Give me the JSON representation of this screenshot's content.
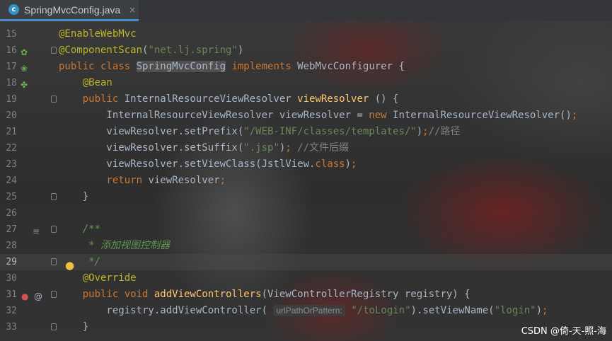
{
  "tab": {
    "icon_letter": "c",
    "label": "SpringMvcConfig.java",
    "close": "×"
  },
  "lines": [
    {
      "n": "15",
      "segs": [
        {
          "c": "an",
          "t": "@EnableWebMvc"
        }
      ]
    },
    {
      "n": "16",
      "segs": [
        {
          "c": "an",
          "t": "@ComponentScan"
        },
        {
          "c": "pl",
          "t": "("
        },
        {
          "c": "st",
          "t": "\"net.lj.spring\""
        },
        {
          "c": "pl",
          "t": ")"
        }
      ]
    },
    {
      "n": "17",
      "segs": [
        {
          "c": "kw",
          "t": "public class "
        },
        {
          "c": "pl hl",
          "t": "SpringMvcConfig"
        },
        {
          "c": "kw",
          "t": " implements "
        },
        {
          "c": "pl",
          "t": "WebMvcConfigurer {"
        }
      ]
    },
    {
      "n": "18",
      "segs": [
        {
          "c": "pl",
          "t": "    "
        },
        {
          "c": "an",
          "t": "@Bean"
        }
      ]
    },
    {
      "n": "19",
      "segs": [
        {
          "c": "kw",
          "t": "    public "
        },
        {
          "c": "pl",
          "t": "InternalResourceViewResolver "
        },
        {
          "c": "fn",
          "t": "viewResolver"
        },
        {
          "c": "pl",
          "t": " () {"
        }
      ]
    },
    {
      "n": "20",
      "segs": [
        {
          "c": "pl",
          "t": "        InternalResourceViewResolver viewResolver = "
        },
        {
          "c": "kw",
          "t": "new "
        },
        {
          "c": "pl",
          "t": "InternalResourceViewResolver()"
        },
        {
          "c": "kw",
          "t": ";"
        }
      ]
    },
    {
      "n": "21",
      "segs": [
        {
          "c": "pl",
          "t": "        viewResolver.setPrefix("
        },
        {
          "c": "st",
          "t": "\"/WEB-INF/classes/templates/\""
        },
        {
          "c": "pl",
          "t": ")"
        },
        {
          "c": "kw",
          "t": ";"
        },
        {
          "c": "cm",
          "t": "//路径"
        }
      ]
    },
    {
      "n": "22",
      "segs": [
        {
          "c": "pl",
          "t": "        viewResolver.setSuffix("
        },
        {
          "c": "st",
          "t": "\".jsp\""
        },
        {
          "c": "pl",
          "t": ")"
        },
        {
          "c": "kw",
          "t": ";"
        },
        {
          "c": "cm",
          "t": " //文件后缀"
        }
      ]
    },
    {
      "n": "23",
      "segs": [
        {
          "c": "pl",
          "t": "        viewResolver.setViewClass(JstlView."
        },
        {
          "c": "kw",
          "t": "class"
        },
        {
          "c": "pl",
          "t": ")"
        },
        {
          "c": "kw",
          "t": ";"
        }
      ]
    },
    {
      "n": "24",
      "segs": [
        {
          "c": "kw",
          "t": "        return "
        },
        {
          "c": "pl",
          "t": "viewResolver"
        },
        {
          "c": "kw",
          "t": ";"
        }
      ]
    },
    {
      "n": "25",
      "segs": [
        {
          "c": "pl",
          "t": "    }"
        }
      ]
    },
    {
      "n": "26",
      "segs": []
    },
    {
      "n": "27",
      "segs": [
        {
          "c": "dc",
          "t": "    /**"
        }
      ]
    },
    {
      "n": "28",
      "segs": [
        {
          "c": "dc",
          "t": "     * 添加视图控制器"
        }
      ]
    },
    {
      "n": "29",
      "segs": [
        {
          "c": "dc",
          "t": "     */"
        }
      ]
    },
    {
      "n": "30",
      "segs": [
        {
          "c": "pl",
          "t": "    "
        },
        {
          "c": "an",
          "t": "@Override"
        }
      ]
    },
    {
      "n": "31",
      "segs": [
        {
          "c": "kw",
          "t": "    public void "
        },
        {
          "c": "fn",
          "t": "addViewControllers"
        },
        {
          "c": "pl",
          "t": "(ViewControllerRegistry registry) {"
        }
      ]
    },
    {
      "n": "32",
      "segs": [
        {
          "c": "pl",
          "t": "        registry.addViewController( "
        },
        {
          "c": "hint",
          "t": "urlPathOrPattern:"
        },
        {
          "c": "pl",
          "t": " "
        },
        {
          "c": "st",
          "t": "\"/toLogin\""
        },
        {
          "c": "pl",
          "t": ").setViewName("
        },
        {
          "c": "st",
          "t": "\"login\""
        },
        {
          "c": "pl",
          "t": ")"
        },
        {
          "c": "kw",
          "t": ";"
        }
      ]
    },
    {
      "n": "33",
      "segs": [
        {
          "c": "pl",
          "t": "    }"
        }
      ]
    }
  ],
  "watermark": "CSDN @倚-天-照-海",
  "colors": {
    "keyword": "#cc7832",
    "annotation": "#bbb529",
    "string": "#6a8759",
    "comment": "#808080",
    "doc_comment": "#629755",
    "method": "#ffc66d",
    "plain": "#a9b7c6"
  }
}
